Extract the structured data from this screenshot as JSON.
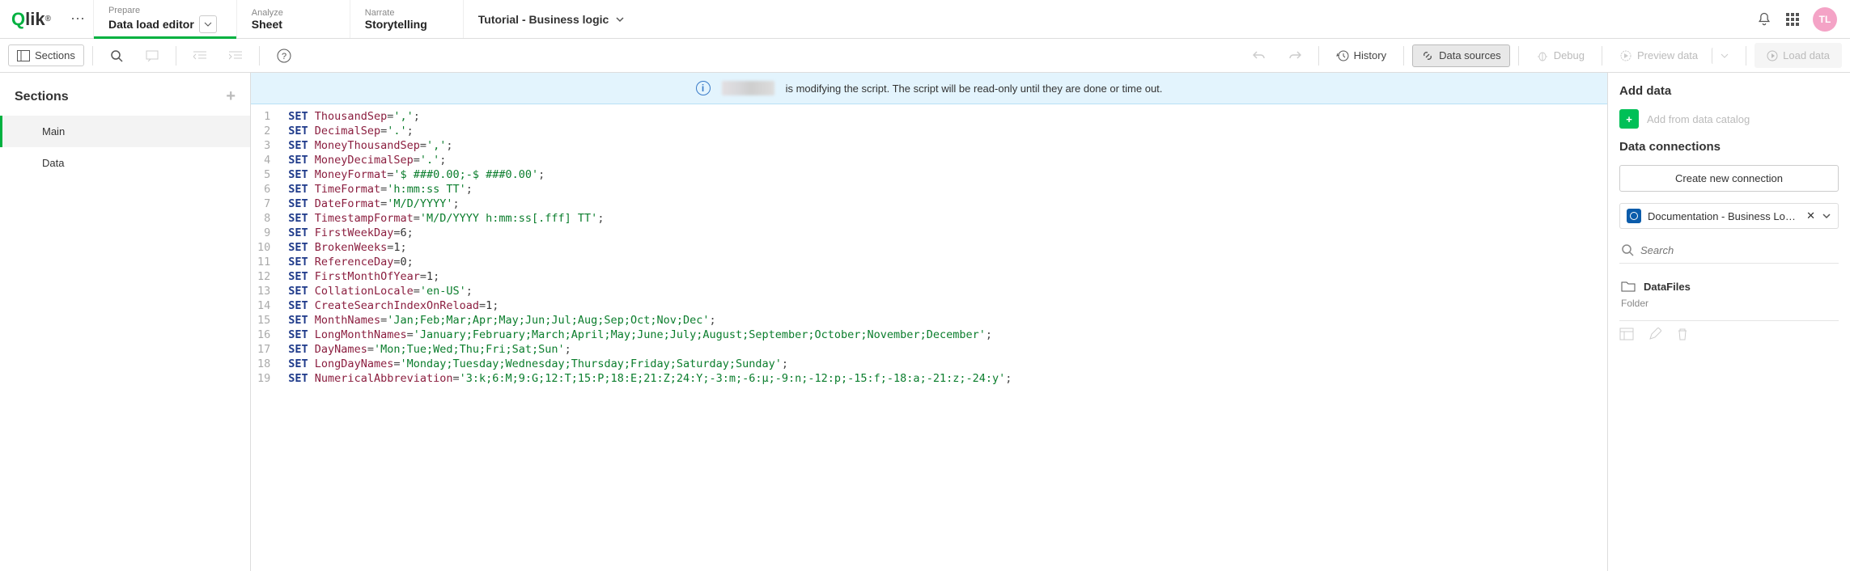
{
  "header": {
    "logo_text": "Qlik",
    "nav": [
      {
        "label": "Prepare",
        "value": "Data load editor",
        "active": true,
        "dropdown": true
      },
      {
        "label": "Analyze",
        "value": "Sheet",
        "active": false
      },
      {
        "label": "Narrate",
        "value": "Storytelling",
        "active": false
      }
    ],
    "app_title": "Tutorial - Business logic",
    "avatar": "TL"
  },
  "toolbar": {
    "sections": "Sections",
    "history": "History",
    "data_sources": "Data sources",
    "debug": "Debug",
    "preview": "Preview data",
    "load": "Load data"
  },
  "sections_panel": {
    "title": "Sections",
    "items": [
      {
        "label": "Main",
        "active": true
      },
      {
        "label": "Data",
        "active": false
      }
    ]
  },
  "notice": {
    "text": "is modifying the script. The script will be read-only until they are done or time out."
  },
  "code": [
    [
      [
        "kw",
        "SET"
      ],
      [
        " "
      ],
      [
        "var",
        "ThousandSep"
      ],
      [
        "op",
        "="
      ],
      [
        "str",
        "','"
      ],
      [
        "op",
        ";"
      ]
    ],
    [
      [
        "kw",
        "SET"
      ],
      [
        " "
      ],
      [
        "var",
        "DecimalSep"
      ],
      [
        "op",
        "="
      ],
      [
        "str",
        "'.'"
      ],
      [
        "op",
        ";"
      ]
    ],
    [
      [
        "kw",
        "SET"
      ],
      [
        " "
      ],
      [
        "var",
        "MoneyThousandSep"
      ],
      [
        "op",
        "="
      ],
      [
        "str",
        "','"
      ],
      [
        "op",
        ";"
      ]
    ],
    [
      [
        "kw",
        "SET"
      ],
      [
        " "
      ],
      [
        "var",
        "MoneyDecimalSep"
      ],
      [
        "op",
        "="
      ],
      [
        "str",
        "'.'"
      ],
      [
        "op",
        ";"
      ]
    ],
    [
      [
        "kw",
        "SET"
      ],
      [
        " "
      ],
      [
        "var",
        "MoneyFormat"
      ],
      [
        "op",
        "="
      ],
      [
        "str",
        "'$ ###0.00;-$ ###0.00'"
      ],
      [
        "op",
        ";"
      ]
    ],
    [
      [
        "kw",
        "SET"
      ],
      [
        " "
      ],
      [
        "var",
        "TimeFormat"
      ],
      [
        "op",
        "="
      ],
      [
        "str",
        "'h:mm:ss TT'"
      ],
      [
        "op",
        ";"
      ]
    ],
    [
      [
        "kw",
        "SET"
      ],
      [
        " "
      ],
      [
        "var",
        "DateFormat"
      ],
      [
        "op",
        "="
      ],
      [
        "str",
        "'M/D/YYYY'"
      ],
      [
        "op",
        ";"
      ]
    ],
    [
      [
        "kw",
        "SET"
      ],
      [
        " "
      ],
      [
        "var",
        "TimestampFormat"
      ],
      [
        "op",
        "="
      ],
      [
        "str",
        "'M/D/YYYY h:mm:ss[.fff] TT'"
      ],
      [
        "op",
        ";"
      ]
    ],
    [
      [
        "kw",
        "SET"
      ],
      [
        " "
      ],
      [
        "var",
        "FirstWeekDay"
      ],
      [
        "op",
        "="
      ],
      [
        "num",
        "6"
      ],
      [
        "op",
        ";"
      ]
    ],
    [
      [
        "kw",
        "SET"
      ],
      [
        " "
      ],
      [
        "var",
        "BrokenWeeks"
      ],
      [
        "op",
        "="
      ],
      [
        "num",
        "1"
      ],
      [
        "op",
        ";"
      ]
    ],
    [
      [
        "kw",
        "SET"
      ],
      [
        " "
      ],
      [
        "var",
        "ReferenceDay"
      ],
      [
        "op",
        "="
      ],
      [
        "num",
        "0"
      ],
      [
        "op",
        ";"
      ]
    ],
    [
      [
        "kw",
        "SET"
      ],
      [
        " "
      ],
      [
        "var",
        "FirstMonthOfYear"
      ],
      [
        "op",
        "="
      ],
      [
        "num",
        "1"
      ],
      [
        "op",
        ";"
      ]
    ],
    [
      [
        "kw",
        "SET"
      ],
      [
        " "
      ],
      [
        "var",
        "CollationLocale"
      ],
      [
        "op",
        "="
      ],
      [
        "str",
        "'en-US'"
      ],
      [
        "op",
        ";"
      ]
    ],
    [
      [
        "kw",
        "SET"
      ],
      [
        " "
      ],
      [
        "var",
        "CreateSearchIndexOnReload"
      ],
      [
        "op",
        "="
      ],
      [
        "num",
        "1"
      ],
      [
        "op",
        ";"
      ]
    ],
    [
      [
        "kw",
        "SET"
      ],
      [
        " "
      ],
      [
        "var",
        "MonthNames"
      ],
      [
        "op",
        "="
      ],
      [
        "str",
        "'Jan;Feb;Mar;Apr;May;Jun;Jul;Aug;Sep;Oct;Nov;Dec'"
      ],
      [
        "op",
        ";"
      ]
    ],
    [
      [
        "kw",
        "SET"
      ],
      [
        " "
      ],
      [
        "var",
        "LongMonthNames"
      ],
      [
        "op",
        "="
      ],
      [
        "str",
        "'January;February;March;April;May;June;July;August;September;October;November;December'"
      ],
      [
        "op",
        ";"
      ]
    ],
    [
      [
        "kw",
        "SET"
      ],
      [
        " "
      ],
      [
        "var",
        "DayNames"
      ],
      [
        "op",
        "="
      ],
      [
        "str",
        "'Mon;Tue;Wed;Thu;Fri;Sat;Sun'"
      ],
      [
        "op",
        ";"
      ]
    ],
    [
      [
        "kw",
        "SET"
      ],
      [
        " "
      ],
      [
        "var",
        "LongDayNames"
      ],
      [
        "op",
        "="
      ],
      [
        "str",
        "'Monday;Tuesday;Wednesday;Thursday;Friday;Saturday;Sunday'"
      ],
      [
        "op",
        ";"
      ]
    ],
    [
      [
        "kw",
        "SET"
      ],
      [
        " "
      ],
      [
        "var",
        "NumericalAbbreviation"
      ],
      [
        "op",
        "="
      ],
      [
        "str",
        "'3:k;6:M;9:G;12:T;15:P;18:E;21:Z;24:Y;-3:m;-6:μ;-9:n;-12:p;-15:f;-18:a;-21:z;-24:y'"
      ],
      [
        "op",
        ";"
      ]
    ]
  ],
  "right_panel": {
    "add_data": "Add data",
    "add_catalog": "Add from data catalog",
    "data_connections": "Data connections",
    "create_conn": "Create new connection",
    "connection_name": "Documentation - Business Logic ...",
    "search_placeholder": "Search",
    "datafiles": "DataFiles",
    "datafiles_sub": "Folder"
  }
}
